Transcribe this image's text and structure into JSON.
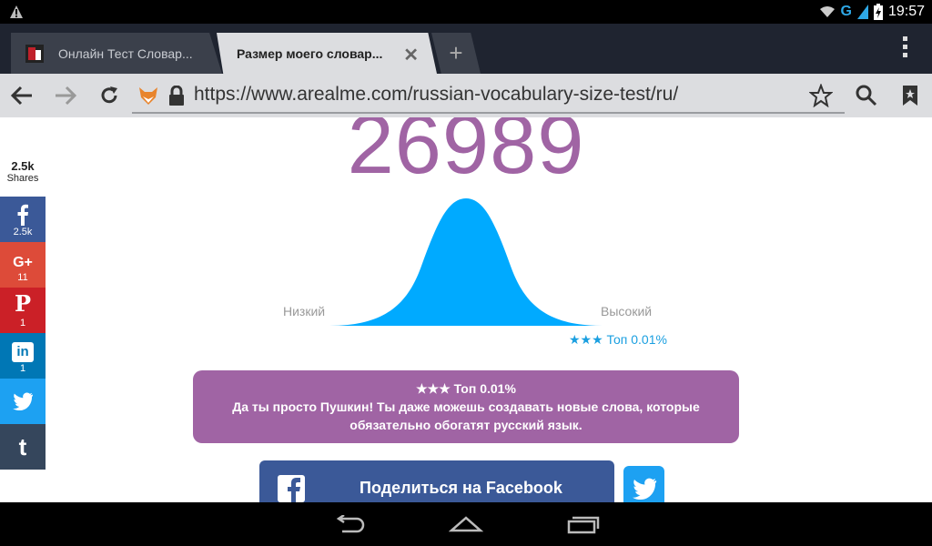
{
  "status": {
    "network": "G",
    "time": "19:57"
  },
  "tabs": [
    {
      "title": "Онлайн Тест Словар...",
      "active": false
    },
    {
      "title": "Размер моего словар...",
      "active": true
    }
  ],
  "toolbar": {
    "url": "https://www.arealme.com/russian-vocabulary-size-test/ru/"
  },
  "result": {
    "score": "26989",
    "low_label": "Низкий",
    "high_label": "Высокий",
    "rank_marker": "★★★ Топ 0.01%",
    "box_title": "★★★ Топ 0.01%",
    "box_message": "Да ты просто Пушкин! Ты даже можешь создавать новые слова, которые обязательно обогатят русский язык."
  },
  "share_sidebar": {
    "total": "2.5k",
    "total_label": "Shares",
    "buttons": [
      {
        "network": "facebook",
        "count": "2.5k",
        "color": "#3b5998"
      },
      {
        "network": "google-plus",
        "count": "11",
        "color": "#dd4b39"
      },
      {
        "network": "pinterest",
        "count": "1",
        "color": "#cb2027"
      },
      {
        "network": "linkedin",
        "count": "1",
        "color": "#0077b5"
      },
      {
        "network": "twitter",
        "count": "",
        "color": "#1da1f2"
      },
      {
        "network": "tumblr",
        "count": "",
        "color": "#35465c"
      }
    ]
  },
  "share_buttons": {
    "facebook_label": "Поделиться на Facebook"
  },
  "colors": {
    "accent_purple": "#a064a4",
    "curve_blue": "#00aaff",
    "toolbar": "#dcdde0"
  }
}
